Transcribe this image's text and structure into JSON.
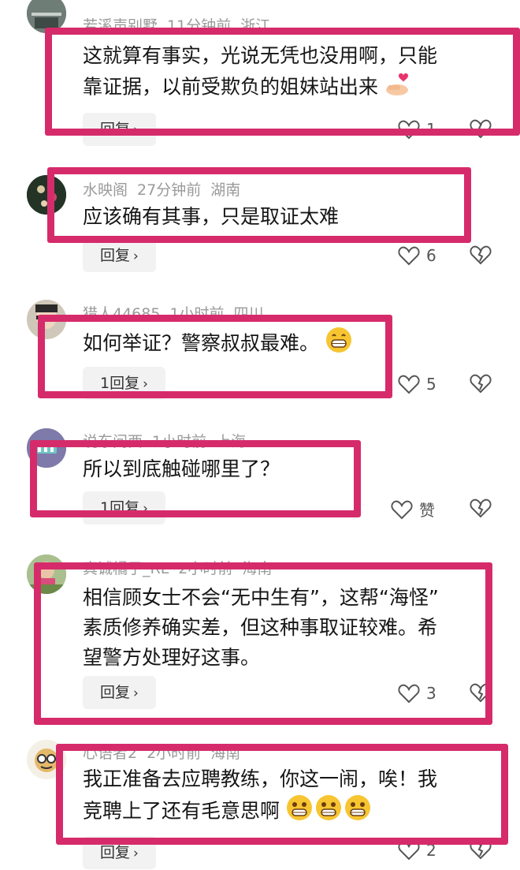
{
  "comments": [
    {
      "username": "若溪声别墅",
      "time": "11分钟前",
      "location": "浙江",
      "text_lines": [
        "这就算有事实，光说无凭也没用啊，只能",
        "靠证据，以前受欺负的姐妹站出来"
      ],
      "emoji": "finger-heart-emoji",
      "reply_label": "回复",
      "likes": "1"
    },
    {
      "username": "水映阁",
      "time": "27分钟前",
      "location": "湖南",
      "text_lines": [
        "应该确有其事，只是取证太难"
      ],
      "reply_label": "回复",
      "likes": "6"
    },
    {
      "username": "猎人44685",
      "time": "1小时前",
      "location": "四川",
      "text_lines": [
        "如何举证？警察叔叔最难。"
      ],
      "emoji": "grinning-emoji",
      "reply_label": "1回复",
      "likes": "5"
    },
    {
      "username": "说东问西",
      "time": "1小时前",
      "location": "上海",
      "text_lines": [
        "所以到底触碰哪里了？"
      ],
      "reply_label": "1回复",
      "likes": "赞"
    },
    {
      "username": "真诚橘子_RL",
      "time": "2小时前",
      "location": "海南",
      "text_lines": [
        "相信顾女士不会“无中生有”，这帮“海怪”",
        "素质修养确实差，但这种事取证较难。希",
        "望警方处理好这事。"
      ],
      "reply_label": "回复",
      "likes": "3"
    },
    {
      "username": "心语者2",
      "time": "2小时前",
      "location": "海南",
      "text_lines": [
        "我正准备去应聘教练，你这一闹，唉！我",
        "竞聘上了还有毛意思啊"
      ],
      "emoji": "grimacing-emoji",
      "reply_label": "回复",
      "likes": "2"
    }
  ],
  "colors": {
    "highlight": "#d62b6b",
    "meta": "#9a9a9a",
    "text": "#161616",
    "reply_bg": "#f2f2f2"
  }
}
